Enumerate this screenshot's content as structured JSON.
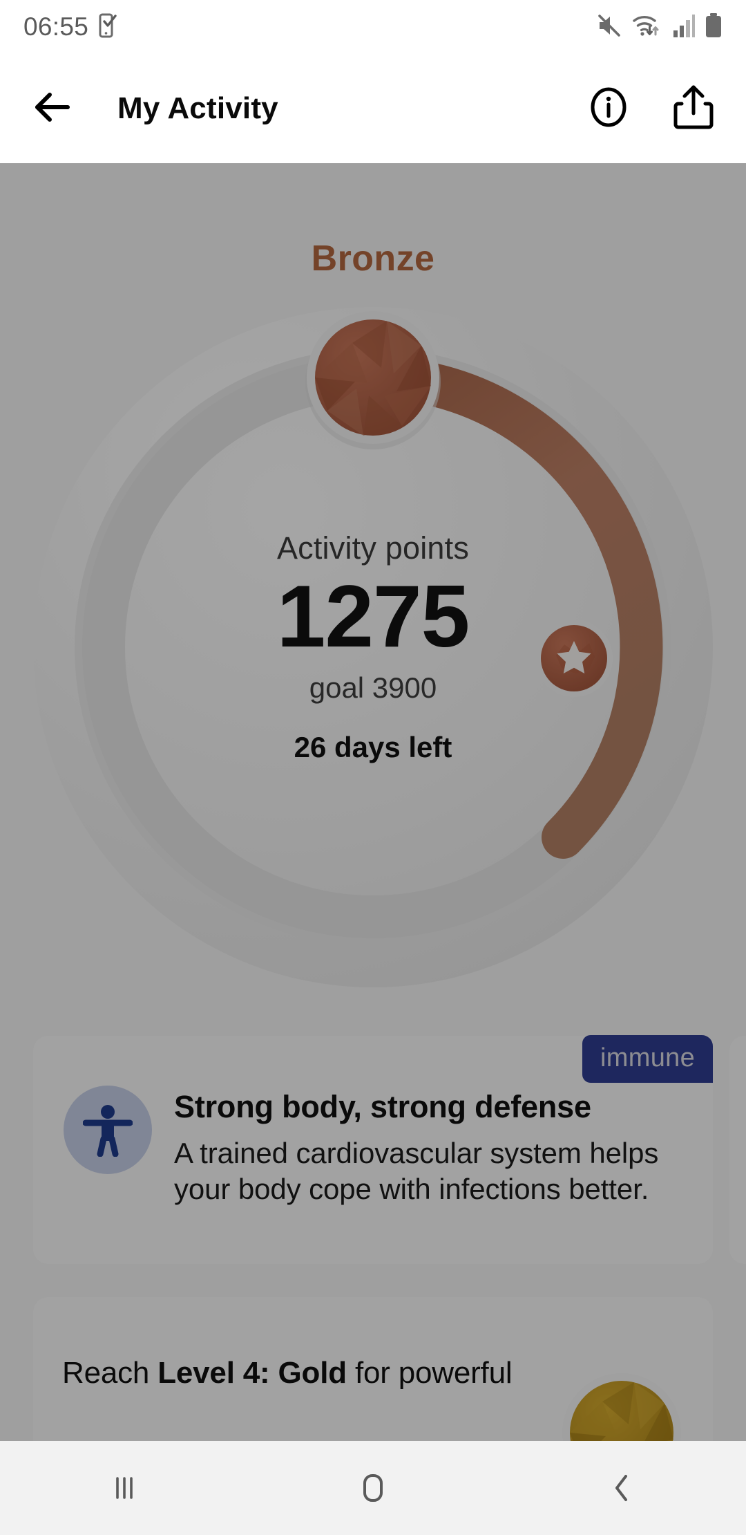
{
  "status_bar": {
    "time": "06:55",
    "icons": [
      "phone-check-icon",
      "mute-icon",
      "wifi-icon",
      "signal-icon",
      "battery-icon"
    ]
  },
  "app_bar": {
    "back_icon": "back-arrow-icon",
    "title": "My Activity",
    "info_icon": "info-icon",
    "share_icon": "share-icon"
  },
  "activity": {
    "tier": "Bronze",
    "tier_color": "#b0663f",
    "points_label": "Activity points",
    "points_value": "1275",
    "goal_label": "goal 3900",
    "days_left": "26 days left",
    "progress_percent": 33,
    "gem_icon": "bronze-gem-icon",
    "milestone_icon": "star-badge-icon"
  },
  "cards": [
    {
      "badge": "immune",
      "badge_color": "#2e3c8f",
      "icon": "accessibility-person-icon",
      "title": "Strong body, strong defense",
      "body": "A trained cardiovascular system helps your body cope with infections better."
    }
  ],
  "next_level_card": {
    "text_prefix": "Reach ",
    "text_bold": "Level 4: Gold",
    "text_suffix": " for powerful",
    "gem_icon": "gold-gem-icon"
  },
  "nav_bar": {
    "recents_icon": "recents-icon",
    "home_icon": "home-icon",
    "back_icon": "nav-back-icon"
  }
}
